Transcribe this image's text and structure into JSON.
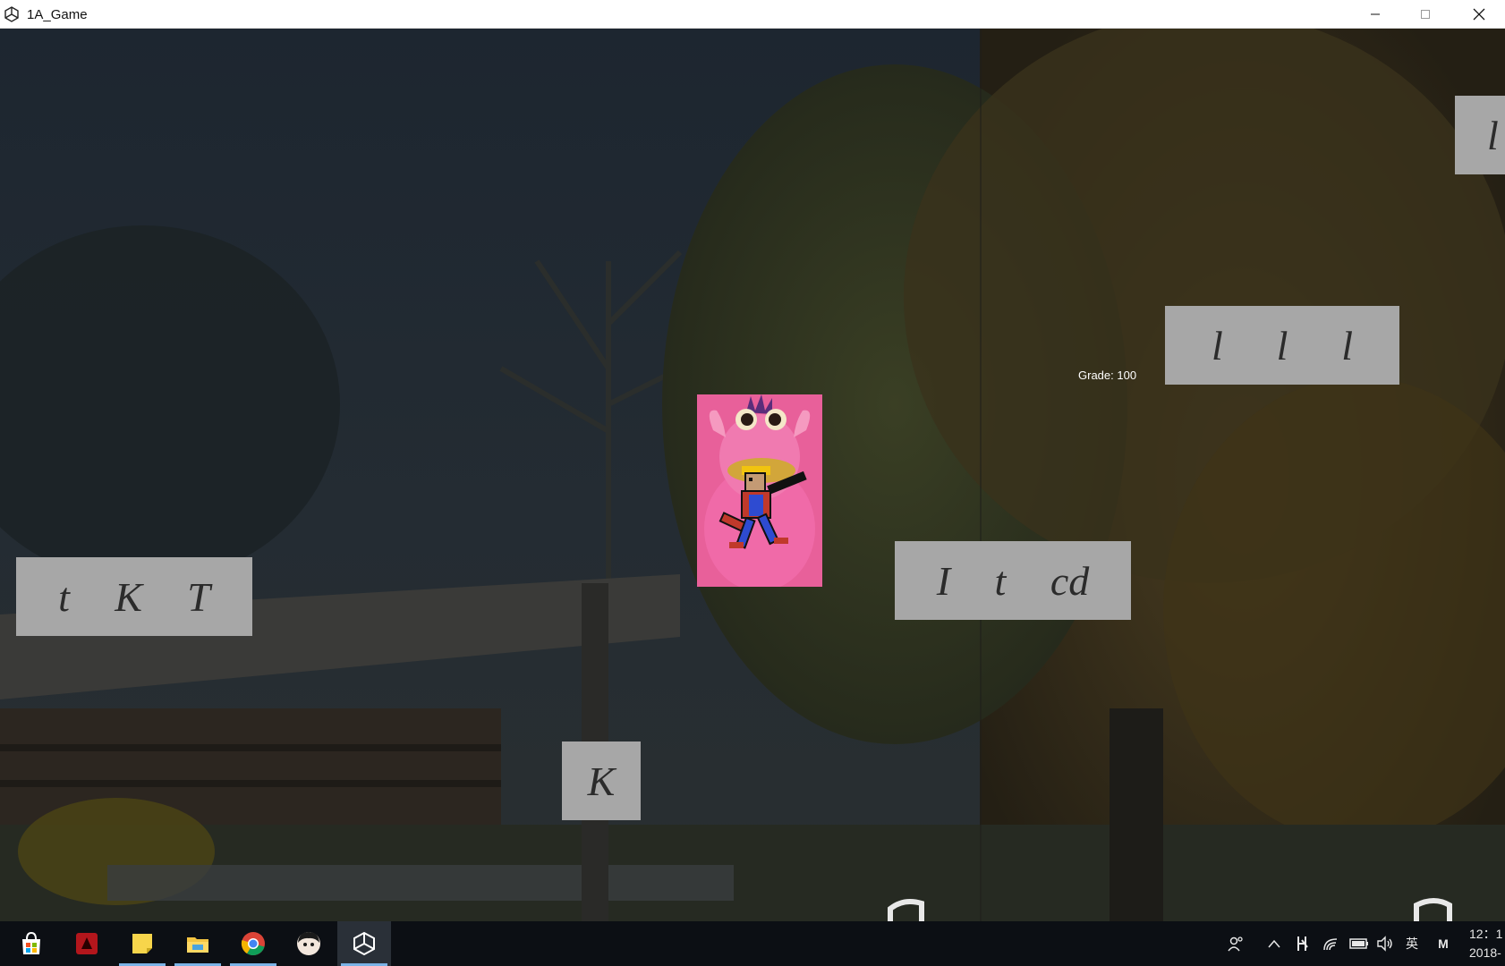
{
  "window": {
    "title": "1A_Game"
  },
  "hud": {
    "grade_text": "Grade: 100"
  },
  "word_boxes": {
    "top_right_partial": [
      "l"
    ],
    "right_middle": [
      "l",
      "l",
      "l"
    ],
    "left": [
      "t",
      "K",
      "T"
    ],
    "center_right": [
      "I",
      "t",
      "cd"
    ],
    "bottom_center": [
      "K"
    ]
  },
  "taskbar": {
    "apps": [
      {
        "name": "store",
        "icon": "store-icon"
      },
      {
        "name": "red-app",
        "icon": "red-app-icon"
      },
      {
        "name": "sticky-notes",
        "icon": "sticky-notes-icon"
      },
      {
        "name": "file-explorer",
        "icon": "folder-icon"
      },
      {
        "name": "chrome",
        "icon": "chrome-icon"
      },
      {
        "name": "avatar-app",
        "icon": "avatar-icon"
      },
      {
        "name": "unity",
        "icon": "unity-icon"
      }
    ],
    "tray": {
      "ime": "英",
      "ime2": "M",
      "clock_time": "12：1",
      "clock_date": "2018-"
    }
  },
  "colors": {
    "word_box_bg": "#a7a7a7",
    "glyph": "#2b2b2b",
    "taskbar": "#0c0f14",
    "accent_underline": "#7ab3e6"
  }
}
